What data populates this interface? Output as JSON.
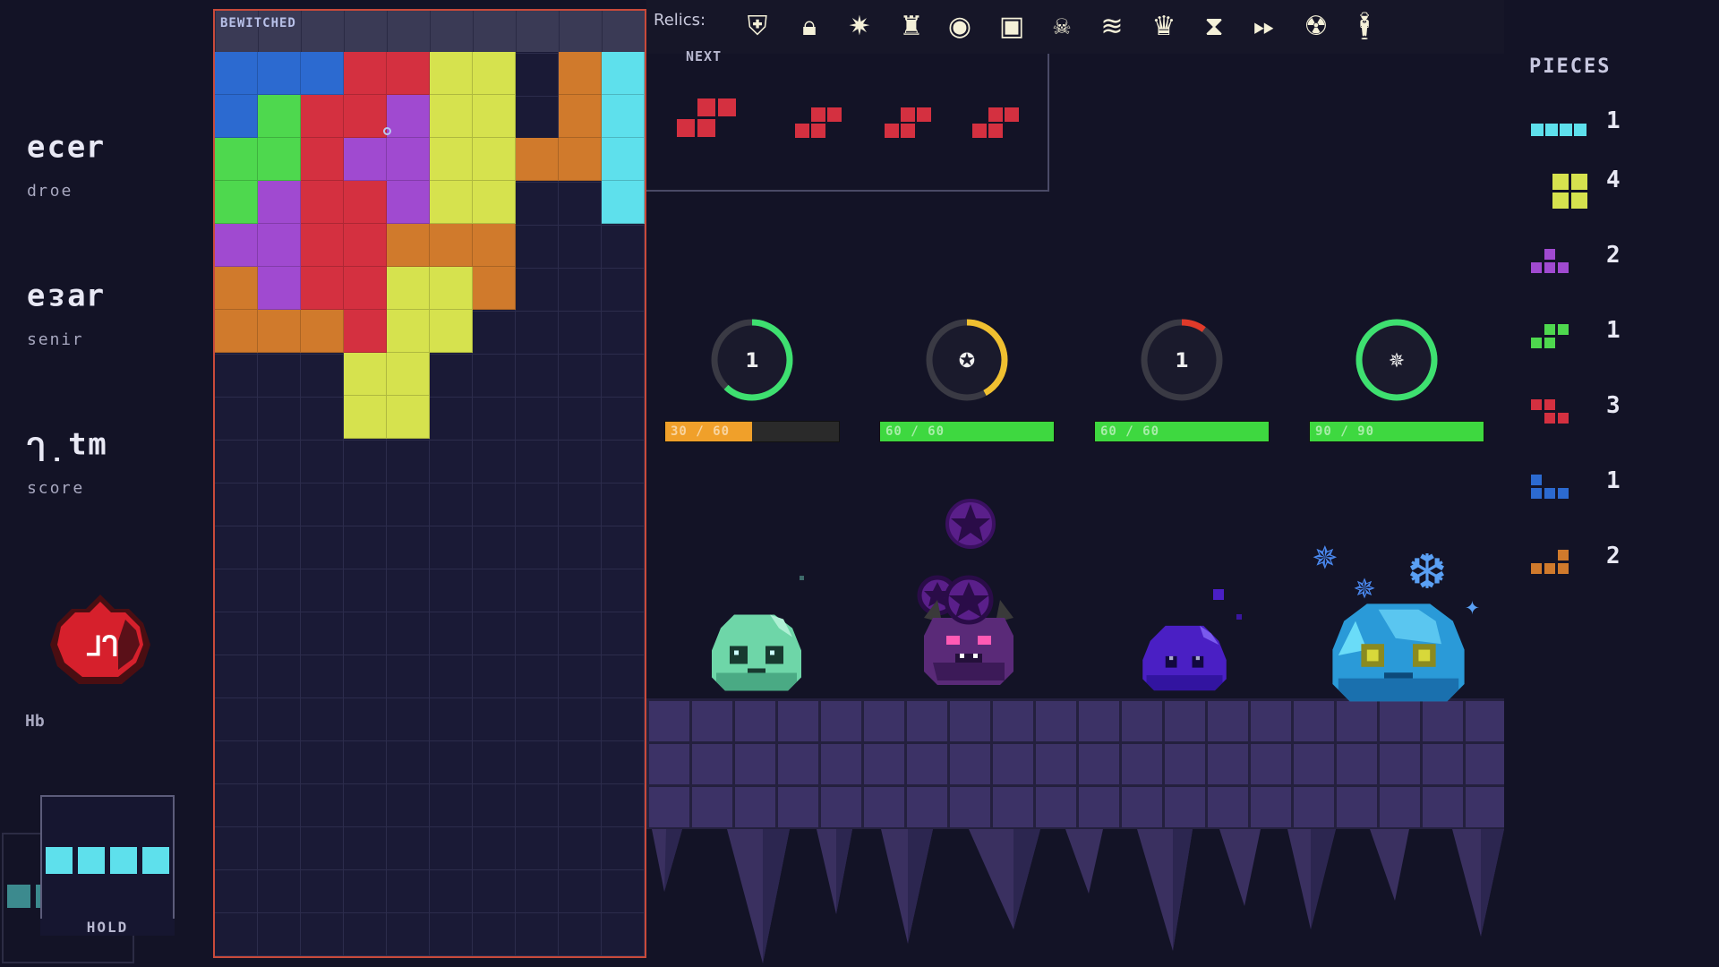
{
  "stats": {
    "gold": {
      "value": "ɹǝɔǝ",
      "label": "ǝoɹp"
    },
    "lines": {
      "value": "ɹɐɛǝ",
      "label": "ɹᴉuǝs"
    },
    "score": {
      "value": "ɯʇ˙ᒐ",
      "label": "ǝɹoɔs"
    }
  },
  "hp": {
    "value": "ᒐᒥ",
    "label": "Hb"
  },
  "hold": {
    "label": "HOLD",
    "piece": "I"
  },
  "board": {
    "label": "BEWITCHED"
  },
  "relics": {
    "label": "Relics:",
    "icons": [
      "shield-icon",
      "lock-icon",
      "sparkle-icon",
      "castle-icon",
      "eye-icon",
      "frame-icon",
      "skull-icon",
      "wind-icon",
      "crown-icon",
      "hourglass-icon",
      "fast-forward-icon",
      "demon-skull-icon",
      "figure-icon"
    ]
  },
  "next": {
    "label": "NEXT"
  },
  "pieces": {
    "title": "PIECES",
    "items": [
      {
        "type": "I",
        "color": "#5ee0ec",
        "count": "1"
      },
      {
        "type": "O",
        "color": "#d6e24e",
        "count": "4"
      },
      {
        "type": "T",
        "color": "#a04ad0",
        "count": "2"
      },
      {
        "type": "S",
        "color": "#4ed84e",
        "count": "1"
      },
      {
        "type": "Z",
        "color": "#d43040",
        "count": "3"
      },
      {
        "type": "J",
        "color": "#2c6ad0",
        "count": "1"
      },
      {
        "type": "L",
        "color": "#d07a2c",
        "count": "2"
      }
    ]
  },
  "enemies": [
    {
      "name": "green-slime",
      "timer": "1",
      "timer_fraction": 0.62,
      "timer_color": "#3ee070",
      "hp_text": "30 / 60",
      "hp_fraction": 0.5,
      "hp_color": "#f0a02a"
    },
    {
      "name": "purple-demon",
      "timer": "pentagram-icon",
      "timer_fraction": 0.42,
      "timer_color": "#f0c030",
      "hp_text": "60 / 60",
      "hp_fraction": 1.0,
      "hp_color": "#3ed840"
    },
    {
      "name": "violet-slime",
      "timer": "1",
      "timer_fraction": 0.1,
      "timer_color": "#e03a2a",
      "hp_text": "60 / 60",
      "hp_fraction": 1.0,
      "hp_color": "#3ed840"
    },
    {
      "name": "ice-slime",
      "timer": "sparkle-icon",
      "timer_fraction": 1.0,
      "timer_color": "#3ee070",
      "hp_text": "90 / 90",
      "hp_fraction": 1.0,
      "hp_color": "#3ed840"
    }
  ],
  "colors": {
    "I": "#5ee0ec",
    "O": "#d6e24e",
    "T": "#a04ad0",
    "S": "#4ed84e",
    "Z": "#d43040",
    "J": "#2c6ad0",
    "L": "#d07a2c"
  },
  "grid": [
    "JJJZZOO.LI",
    "JSZZTOO.LI",
    "SSZTTOOLLI",
    "STZZTOO..I",
    "TTZZLLL...",
    "LTZZOOL...",
    "LLLZOO....",
    "...OO.....",
    "...OO....."
  ]
}
